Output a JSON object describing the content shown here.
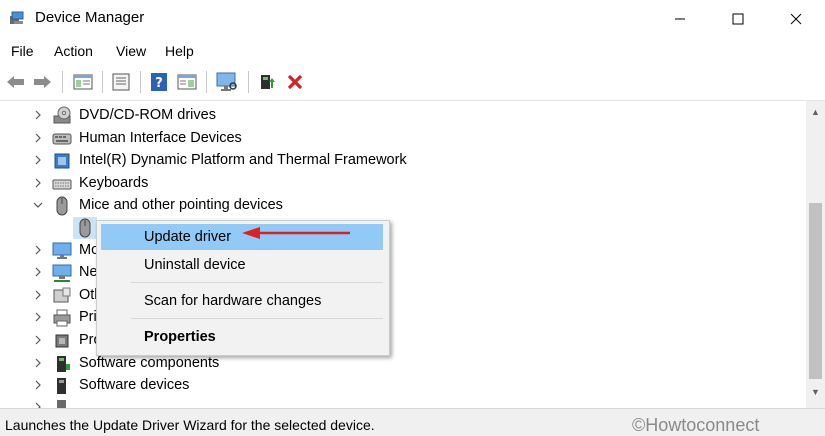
{
  "window": {
    "title": "Device Manager"
  },
  "menu": [
    "File",
    "Action",
    "View",
    "Help"
  ],
  "toolbar_icons": [
    "back-icon",
    "forward-icon",
    "properties-icon",
    "update-icon",
    "help-icon",
    "properties-pane-icon",
    "monitor-scan-icon",
    "enable-device-icon",
    "uninstall-icon"
  ],
  "tree": [
    {
      "label": "DVD/CD-ROM drives",
      "expanded": false,
      "icon": "dvd-icon"
    },
    {
      "label": "Human Interface Devices",
      "expanded": false,
      "icon": "hid-icon"
    },
    {
      "label": "Intel(R) Dynamic Platform and Thermal Framework",
      "expanded": false,
      "icon": "chip-icon"
    },
    {
      "label": "Keyboards",
      "expanded": false,
      "icon": "keyboard-icon"
    },
    {
      "label": "Mice and other pointing devices",
      "expanded": true,
      "icon": "mouse-icon"
    },
    {
      "label": "",
      "expanded": null,
      "icon": "mouse-icon"
    },
    {
      "label": "Mo",
      "expanded": false,
      "icon": "monitor-icon"
    },
    {
      "label": "Net",
      "expanded": false,
      "icon": "network-icon"
    },
    {
      "label": "Oth",
      "expanded": false,
      "icon": "other-icon"
    },
    {
      "label": "Prin",
      "expanded": false,
      "icon": "printer-icon"
    },
    {
      "label": "Pro",
      "expanded": false,
      "icon": "processor-icon"
    },
    {
      "label": "Software components",
      "expanded": false,
      "icon": "software-component-icon"
    },
    {
      "label": "Software devices",
      "expanded": false,
      "icon": "software-device-icon"
    },
    {
      "label": "",
      "expanded": false,
      "icon": "sound-icon"
    }
  ],
  "context_menu": {
    "update": "Update driver",
    "uninstall": "Uninstall device",
    "scan": "Scan for hardware changes",
    "properties": "Properties"
  },
  "status": {
    "text": "Launches the Update Driver Wizard for the selected device.",
    "watermark": "©Howtoconnect"
  },
  "colors": {
    "highlight": "#91c9f7",
    "arrow": "#e02020",
    "menu_bg": "#f2f2f2"
  }
}
